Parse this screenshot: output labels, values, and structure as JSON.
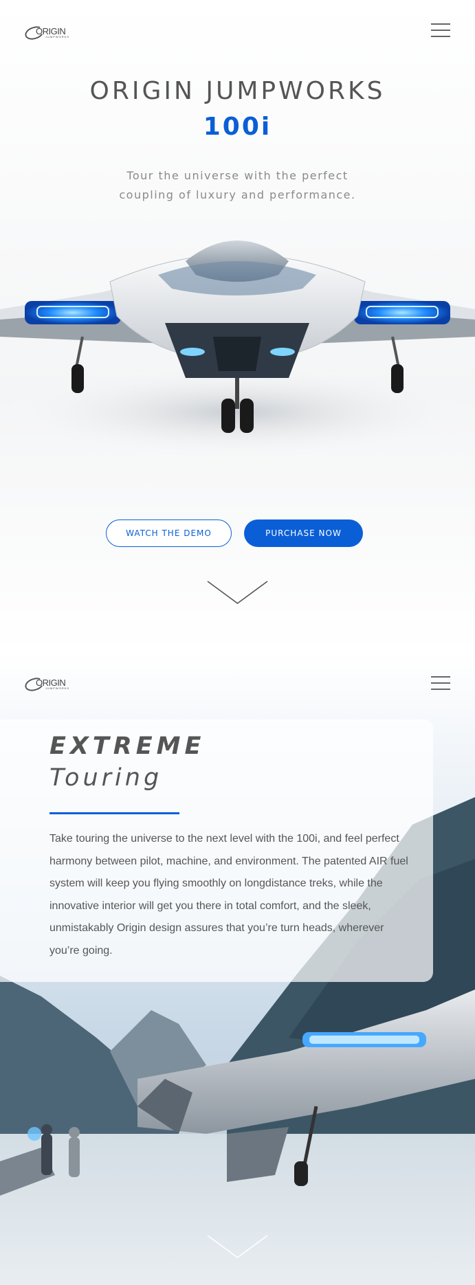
{
  "header": {
    "logo_text": "ORIGIN",
    "logo_subtext": "JUMPWORKS"
  },
  "hero": {
    "title": "ORIGIN JUMPWORKS",
    "model": "100i",
    "tagline_line1": "Tour the universe with the perfect",
    "tagline_line2": "coupling of luxury and performance.",
    "demo_button": "WATCH THE DEMO",
    "purchase_button": "PURCHASE NOW"
  },
  "feature": {
    "title": "EXTREME",
    "subtitle": "Touring",
    "body": "Take touring the universe to the next level with the 100i, and feel perfect harmony between pilot, machine, and environment. The patented AIR fuel system will keep you flying smoothly on longdistance treks, while the innovative interior will get you there in total comfort, and the sleek, unmistakably Origin design assures that you’re turn heads, wherever you’re going."
  },
  "colors": {
    "accent": "#0a5fd6",
    "text": "#555555",
    "muted": "#8a8a8a"
  },
  "icons": {
    "menu": "hamburger-menu-icon",
    "scroll": "chevron-down-icon"
  }
}
